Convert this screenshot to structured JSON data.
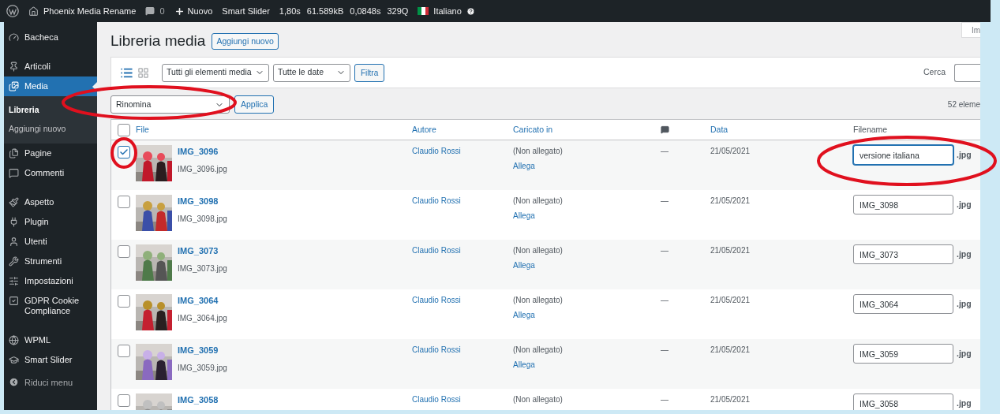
{
  "admin_bar": {
    "site": "Phoenix Media Rename",
    "comments": "0",
    "new": "Nuovo",
    "plugin": "Smart Slider",
    "stats": [
      "1,80s",
      "61.589kB",
      "0,0848s",
      "329Q"
    ],
    "language": "Italiano"
  },
  "sidebar": {
    "items": [
      {
        "label": "Bacheca",
        "selected": false
      },
      {
        "label": "Articoli",
        "selected": false
      },
      {
        "label": "Media",
        "selected": true,
        "children": [
          {
            "label": "Libreria",
            "selected": true
          },
          {
            "label": "Aggiungi nuovo",
            "selected": false
          }
        ]
      },
      {
        "label": "Pagine",
        "selected": false
      },
      {
        "label": "Commenti",
        "selected": false
      },
      {
        "label": "Aspetto",
        "selected": false
      },
      {
        "label": "Plugin",
        "selected": false
      },
      {
        "label": "Utenti",
        "selected": false
      },
      {
        "label": "Strumenti",
        "selected": false
      },
      {
        "label": "Impostazioni",
        "selected": false
      },
      {
        "label": "GDPR Cookie Compliance",
        "selected": false
      },
      {
        "label": "WPML",
        "selected": false
      },
      {
        "label": "Smart Slider",
        "selected": false
      }
    ],
    "collapse": "Riduci menu"
  },
  "page": {
    "title": "Libreria media",
    "add_new": "Aggiungi nuovo",
    "screen_options": "Im"
  },
  "filters": {
    "type": "Tutti gli elementi media",
    "date": "Tutte le date",
    "button": "Filtra",
    "search_label": "Cerca"
  },
  "bulk": {
    "action": "Rinomina",
    "apply": "Applica",
    "count": "52 eleme"
  },
  "table": {
    "columns": [
      "File",
      "Autore",
      "Caricato in",
      "Data",
      "Filename"
    ],
    "all_checked": false,
    "rows": [
      {
        "title": "IMG_3096",
        "file": "IMG_3096.jpg",
        "author": "Claudio Rossi",
        "attached": "(Non allegato)",
        "attach": "Allega",
        "comments": "—",
        "date": "21/05/2021",
        "filename": "versione italiana",
        "ext": ".jpg",
        "checked": true,
        "focused": true
      },
      {
        "title": "IMG_3098",
        "file": "IMG_3098.jpg",
        "author": "Claudio Rossi",
        "attached": "(Non allegato)",
        "attach": "Allega",
        "comments": "—",
        "date": "21/05/2021",
        "filename": "IMG_3098",
        "ext": ".jpg",
        "checked": false,
        "focused": false
      },
      {
        "title": "IMG_3073",
        "file": "IMG_3073.jpg",
        "author": "Claudio Rossi",
        "attached": "(Non allegato)",
        "attach": "Allega",
        "comments": "—",
        "date": "21/05/2021",
        "filename": "IMG_3073",
        "ext": ".jpg",
        "checked": false,
        "focused": false
      },
      {
        "title": "IMG_3064",
        "file": "IMG_3064.jpg",
        "author": "Claudio Rossi",
        "attached": "(Non allegato)",
        "attach": "Allega",
        "comments": "—",
        "date": "21/05/2021",
        "filename": "IMG_3064",
        "ext": ".jpg",
        "checked": false,
        "focused": false
      },
      {
        "title": "IMG_3059",
        "file": "IMG_3059.jpg",
        "author": "Claudio Rossi",
        "attached": "(Non allegato)",
        "attach": "Allega",
        "comments": "—",
        "date": "21/05/2021",
        "filename": "IMG_3059",
        "ext": ".jpg",
        "checked": false,
        "focused": false
      },
      {
        "title": "IMG_3058",
        "author": "Claudio Rossi",
        "attached": "(Non allegato)",
        "comments": "—",
        "date": "21/05/2021",
        "filename": "IMG_3058",
        "ext": ".jpg",
        "checked": false,
        "focused": false
      }
    ]
  }
}
